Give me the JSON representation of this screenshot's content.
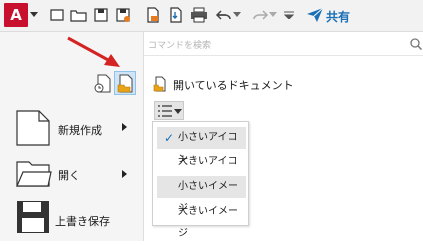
{
  "app": {
    "logo_letter": "A",
    "brand_color": "#c8102e"
  },
  "toolbar": {
    "icons": [
      "new-icon",
      "open-icon",
      "save-icon",
      "save-as-icon",
      "publish-icon",
      "import-icon",
      "plot-icon",
      "undo-icon",
      "redo-icon",
      "customize-icon",
      "share-icon"
    ],
    "share_label": "共有"
  },
  "search": {
    "placeholder": "コマンドを検索"
  },
  "left_menu": {
    "items": [
      {
        "label": "新規作成",
        "icon": "new-document-icon",
        "has_submenu": true
      },
      {
        "label": "開く",
        "icon": "folder-icon",
        "has_submenu": true
      },
      {
        "label": "上書き保存",
        "icon": "floppy-disk-icon",
        "has_submenu": false
      }
    ]
  },
  "panel": {
    "heading": "開いているドキュメント"
  },
  "view_menu": {
    "items": [
      {
        "label": "小さいアイコン",
        "checked": true
      },
      {
        "label": "大きいアイコン",
        "checked": false
      },
      {
        "label": "小さいイメージ",
        "checked": false
      },
      {
        "label": "大きいイメージ",
        "checked": false
      }
    ]
  },
  "colors": {
    "accent": "#1a6fb5",
    "annotation_arrow": "#d32323"
  }
}
